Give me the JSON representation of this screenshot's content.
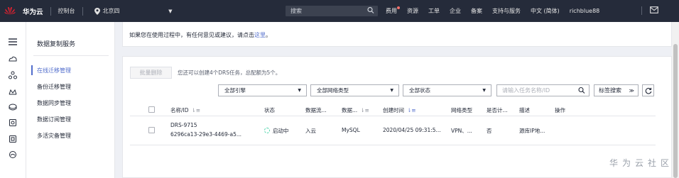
{
  "topbar": {
    "logo_text": "HUAWEI",
    "brand": "华为云",
    "console": "控制台",
    "region": "北京四",
    "search_placeholder": "搜索",
    "nav": [
      "费用",
      "资源",
      "工单",
      "企业",
      "备案",
      "支持与服务",
      "中文 (简体)",
      "richblue88"
    ]
  },
  "sidebar": {
    "title": "数据复制服务",
    "items": [
      "在线迁移管理",
      "备份迁移管理",
      "数据同步管理",
      "数据订阅管理",
      "多活灾备管理"
    ],
    "active_index": 0
  },
  "notice": {
    "text": "如果您在使用过程中，有任何意见或建议，请点击",
    "link": "这里",
    "suffix": "。"
  },
  "toolbar": {
    "batch_delete": "批量删除",
    "quota_text": "您还可以创建4个DRS任务，总配额为5个。",
    "filters": [
      "全部引擎",
      "全部网络类型",
      "全部状态"
    ],
    "task_search_placeholder": "请输入任务名称/ID",
    "tag_search": "标签搜索"
  },
  "table": {
    "headers": [
      "名称/ID",
      "状态",
      "数据流...",
      "数据...",
      "创建时间",
      "网络类型",
      "是否计...",
      "描述",
      "操作"
    ],
    "rows": [
      {
        "name": "DRS-9715",
        "id": "6296ca13-29e3-4469-a5...",
        "status": "启动中",
        "flow": "入云",
        "engine": "MySQL",
        "created": "2020/04/25 09:31:5...",
        "network": "VPN、...",
        "billing": "否",
        "desc": "源库IP地..."
      }
    ]
  },
  "watermark": "华为云社区",
  "colors": {
    "topbar": "#252b3a",
    "accent": "#526ecc",
    "status_starting": "#50d4ab"
  }
}
